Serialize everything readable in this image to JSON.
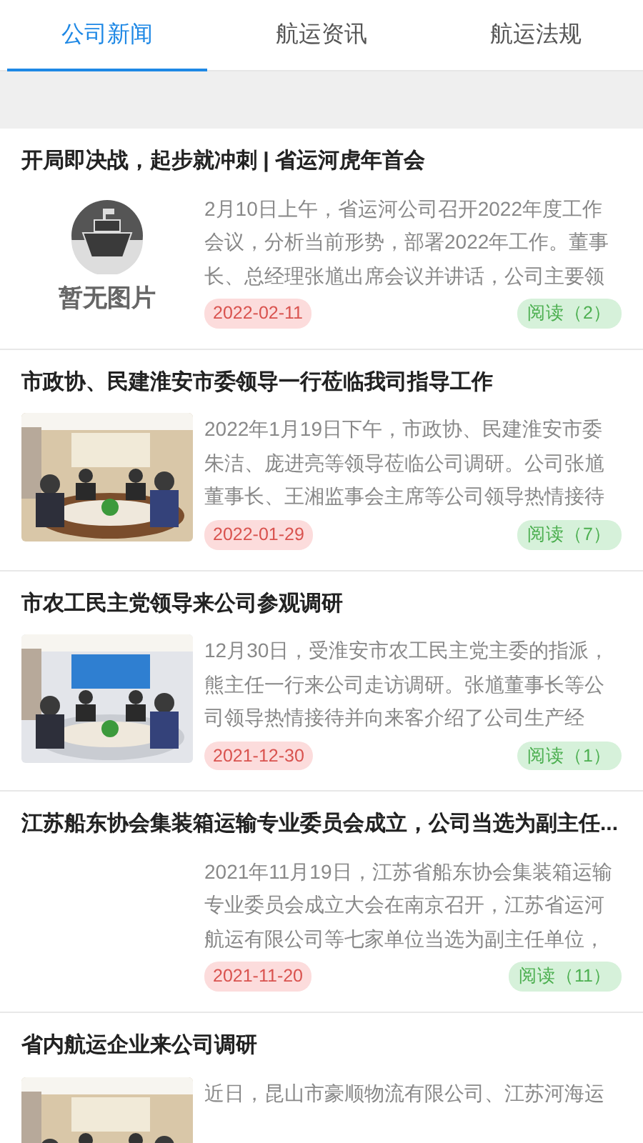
{
  "tabs": [
    {
      "label": "公司新闻",
      "selected": true
    },
    {
      "label": "航运资讯",
      "selected": false
    },
    {
      "label": "航运法规",
      "selected": false
    }
  ],
  "articles": [
    {
      "title": "开局即决战，起步就冲刺 | 省运河虎年首会",
      "image": {
        "kind": "placeholder",
        "label": "暂无图片"
      },
      "summary": "2月10日上午，省运河公司召开2022年度工作会议，分析当前形势，部署2022年工作。董事长、总经理张馗出席会议并讲话，公司主要领",
      "date": "2022-02-11",
      "reads": "阅读（2）"
    },
    {
      "title": "市政协、民建淮安市委领导一行莅临我司指导工作",
      "summary": "2022年1月19日下午，市政协、民建淮安市委朱洁、庞进亮等领导莅临公司调研。公司张馗董事长、王湘监事会主席等公司领导热情接待",
      "date": "2022-01-29",
      "reads": "阅读（7）"
    },
    {
      "title": "市农工民主党领导来公司参观调研",
      "summary": "12月30日，受淮安市农工民主党主委的指派，熊主任一行来公司走访调研。张馗董事长等公司领导热情接待并向来客介绍了公司生产经",
      "date": "2021-12-30",
      "reads": "阅读（1）"
    },
    {
      "title": "江苏船东协会集装箱运输专业委员会成立，公司当选为副主任...",
      "image": {
        "kind": "none"
      },
      "summary": "2021年11月19日，江苏省船东协会集装箱运输专业委员会成立大会在南京召开，江苏省运河航运有限公司等七家单位当选为副主任单位，",
      "date": "2021-11-20",
      "reads": "阅读（11）"
    },
    {
      "title": "省内航运企业来公司调研",
      "summary": "近日，昆山市豪顺物流有限公司、江苏河海运"
    }
  ]
}
